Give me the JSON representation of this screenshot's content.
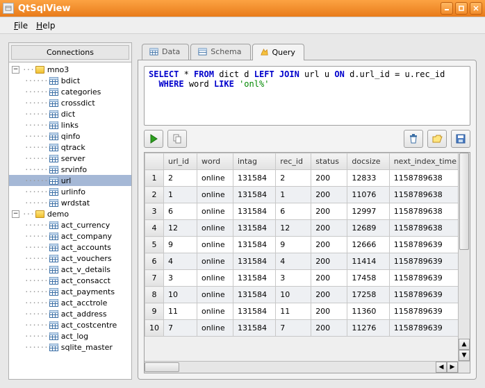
{
  "window": {
    "title": "QtSqlView"
  },
  "menu": {
    "file": "File",
    "help": "Help"
  },
  "sidebar": {
    "header": "Connections",
    "databases": [
      {
        "name": "mno3",
        "expanded": true,
        "tables": [
          "bdict",
          "categories",
          "crossdict",
          "dict",
          "links",
          "qinfo",
          "qtrack",
          "server",
          "srvinfo",
          "url",
          "urlinfo",
          "wrdstat"
        ],
        "selected_index": 9
      },
      {
        "name": "demo",
        "expanded": true,
        "tables": [
          "act_currency",
          "act_company",
          "act_accounts",
          "act_vouchers",
          "act_v_details",
          "act_consacct",
          "act_payments",
          "act_acctrole",
          "act_address",
          "act_costcentre",
          "act_log",
          "sqlite_master"
        ],
        "selected_index": -1
      }
    ]
  },
  "tabs": {
    "data": "Data",
    "schema": "Schema",
    "query": "Query",
    "active": "query"
  },
  "query_tokens": [
    {
      "t": "kw",
      "v": "SELECT"
    },
    {
      "t": "sp",
      "v": " "
    },
    {
      "t": "id",
      "v": "* "
    },
    {
      "t": "kw",
      "v": "FROM"
    },
    {
      "t": "sp",
      "v": " "
    },
    {
      "t": "id",
      "v": "dict d "
    },
    {
      "t": "kw",
      "v": "LEFT JOIN"
    },
    {
      "t": "sp",
      "v": " "
    },
    {
      "t": "id",
      "v": "url u "
    },
    {
      "t": "kw",
      "v": "ON"
    },
    {
      "t": "sp",
      "v": " "
    },
    {
      "t": "id",
      "v": "d.url_id = u.rec_id"
    },
    {
      "t": "nl",
      "v": "\n  "
    },
    {
      "t": "kw",
      "v": "WHERE"
    },
    {
      "t": "sp",
      "v": " "
    },
    {
      "t": "id",
      "v": "word "
    },
    {
      "t": "kw",
      "v": "LIKE"
    },
    {
      "t": "sp",
      "v": " "
    },
    {
      "t": "str",
      "v": "'onl%'"
    }
  ],
  "result": {
    "columns": [
      "url_id",
      "word",
      "intag",
      "rec_id",
      "status",
      "docsize",
      "next_index_time"
    ],
    "rows": [
      [
        "2",
        "online",
        "131584",
        "2",
        "200",
        "12833",
        "1158789638"
      ],
      [
        "1",
        "online",
        "131584",
        "1",
        "200",
        "11076",
        "1158789638"
      ],
      [
        "6",
        "online",
        "131584",
        "6",
        "200",
        "12997",
        "1158789638"
      ],
      [
        "12",
        "online",
        "131584",
        "12",
        "200",
        "12689",
        "1158789638"
      ],
      [
        "9",
        "online",
        "131584",
        "9",
        "200",
        "12666",
        "1158789639"
      ],
      [
        "4",
        "online",
        "131584",
        "4",
        "200",
        "11414",
        "1158789639"
      ],
      [
        "3",
        "online",
        "131584",
        "3",
        "200",
        "17458",
        "1158789639"
      ],
      [
        "10",
        "online",
        "131584",
        "10",
        "200",
        "17258",
        "1158789639"
      ],
      [
        "11",
        "online",
        "131584",
        "11",
        "200",
        "11360",
        "1158789639"
      ],
      [
        "7",
        "online",
        "131584",
        "7",
        "200",
        "11276",
        "1158789639"
      ]
    ]
  }
}
